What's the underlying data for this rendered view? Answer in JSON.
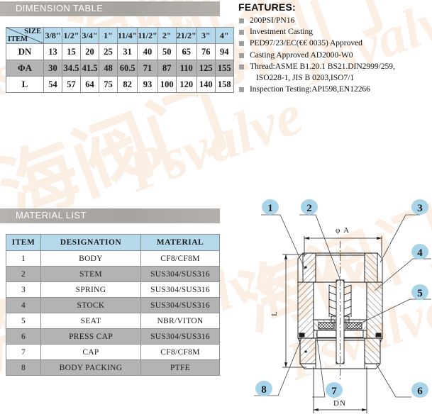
{
  "dimension_section": {
    "title": "DIMENSION TABLE",
    "corner": {
      "size_label": "SIZE",
      "item_label": "ITEM"
    },
    "sizes": [
      "3/8\"",
      "1/2\"",
      "3/4\"",
      "1\"",
      "11/4\"",
      "11/2\"",
      "2\"",
      "21/2\"",
      "3\"",
      "4\""
    ],
    "rows": [
      {
        "label": "DN",
        "values": [
          "13",
          "15",
          "20",
          "25",
          "31",
          "40",
          "50",
          "65",
          "76",
          "94"
        ]
      },
      {
        "label": "ΦA",
        "values": [
          "30",
          "34.5",
          "41.5",
          "48",
          "60.5",
          "71",
          "87",
          "110",
          "125",
          "155"
        ]
      },
      {
        "label": "L",
        "values": [
          "54",
          "57",
          "64",
          "75",
          "82",
          "93",
          "100",
          "120",
          "140",
          "158"
        ]
      }
    ]
  },
  "material_section": {
    "title": "MATERIAL LIST",
    "headers": [
      "ITEM",
      "DESIGNATION",
      "MATERIAL"
    ],
    "rows": [
      {
        "item": "1",
        "designation": "BODY",
        "material": "CF8/CF8M"
      },
      {
        "item": "2",
        "designation": "STEM",
        "material": "SUS304/SUS316"
      },
      {
        "item": "3",
        "designation": "SPRING",
        "material": "SUS304/SUS316"
      },
      {
        "item": "4",
        "designation": "STOCK",
        "material": "SUS304/SUS316"
      },
      {
        "item": "5",
        "designation": "SEAT",
        "material": "NBR/VITON"
      },
      {
        "item": "6",
        "designation": "PRESS CAP",
        "material": "SUS304/SUS316"
      },
      {
        "item": "7",
        "designation": "CAP",
        "material": "CF8/CF8M"
      },
      {
        "item": "8",
        "designation": "BODY PACKING",
        "material": "PTFE"
      }
    ]
  },
  "features": {
    "title": "FEATURES:",
    "items": [
      {
        "text": "200PSI/PN16",
        "continuation": ""
      },
      {
        "text": "Investment Casting",
        "continuation": ""
      },
      {
        "text": "PED97/23/EC(€€ 0035) Approved",
        "continuation": ""
      },
      {
        "text": "Casting Approved AD2000-W0",
        "continuation": ""
      },
      {
        "text": "Thread:ASME B1.20.1 BS21.DIN2999/259,",
        "continuation": "ISO228-1, JIS B 0203,ISO7/1"
      },
      {
        "text": "Inspection Testing:API598,EN12266",
        "continuation": ""
      }
    ]
  },
  "drawing": {
    "callouts": [
      {
        "id": "1",
        "label": "1"
      },
      {
        "id": "2",
        "label": "2"
      },
      {
        "id": "3",
        "label": "3"
      },
      {
        "id": "4",
        "label": "4"
      },
      {
        "id": "5",
        "label": "5"
      },
      {
        "id": "6",
        "label": "6"
      },
      {
        "id": "7",
        "label": "7"
      },
      {
        "id": "8",
        "label": "8"
      }
    ],
    "dimensions": {
      "diameter": "φ A",
      "length": "L",
      "bore": "DN"
    }
  },
  "watermark": {
    "cn_text": "海阀门",
    "en_text": "Psvalve"
  },
  "colors": {
    "header_blue": "#b7d9ec",
    "shade_gray": "#b3b3b3",
    "title_bar_gray": "#aba7a3",
    "bullet_gray": "#a0a0a0",
    "callout_blue": "#a8d4ea",
    "watermark": "#fbeee2"
  }
}
